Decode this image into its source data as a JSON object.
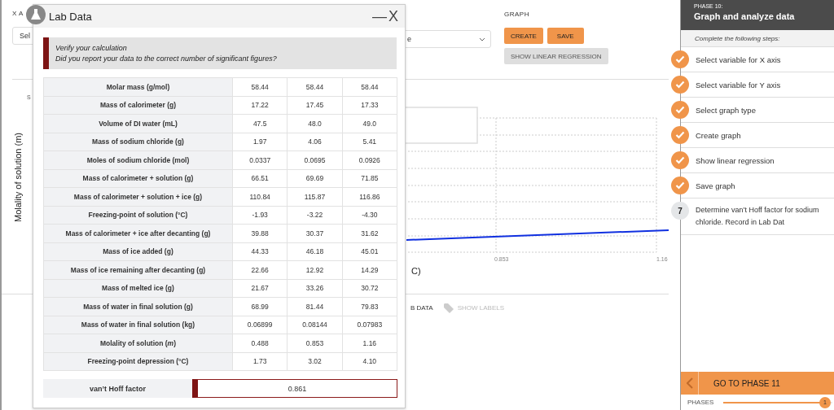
{
  "background": {
    "x_axis_label": "X A",
    "x_select": {
      "value": "Sel"
    },
    "graph_select": {
      "value": "e"
    },
    "graph_label": "GRAPH",
    "buttons": [
      {
        "label": "CREATE",
        "kind": "primary"
      },
      {
        "label": "SAVE",
        "kind": "primary"
      },
      {
        "label": "SHOW LINEAR REGRESSION",
        "kind": "secondary"
      }
    ],
    "side_label": "S",
    "y_axis_label": "Molality of solution (m)",
    "x_ticks": [
      "0.853",
      "1.16"
    ],
    "x_axis_label_fragment": "C)",
    "footer": [
      {
        "label": "B DATA",
        "disabled": false,
        "icon": false
      },
      {
        "label": "SHOW LABELS",
        "disabled": true,
        "icon": true
      }
    ]
  },
  "lab_data": {
    "title": "Lab Data",
    "minimize": "—",
    "close": "X",
    "alert": {
      "title": "Verify your calculation",
      "message": "Did you report your data to the correct number of significant figures?"
    },
    "rows": [
      {
        "label": "Molar mass (g/mol)",
        "values": [
          "58.44",
          "58.44",
          "58.44"
        ]
      },
      {
        "label": "Mass of calorimeter (g)",
        "values": [
          "17.22",
          "17.45",
          "17.33"
        ]
      },
      {
        "label": "Volume of DI water (mL)",
        "values": [
          "47.5",
          "48.0",
          "49.0"
        ]
      },
      {
        "label": "Mass of sodium chloride (g)",
        "values": [
          "1.97",
          "4.06",
          "5.41"
        ]
      },
      {
        "label": "Moles of sodium chloride (mol)",
        "values": [
          "0.0337",
          "0.0695",
          "0.0926"
        ]
      },
      {
        "label": "Mass of calorimeter + solution (g)",
        "values": [
          "66.51",
          "69.69",
          "71.85"
        ]
      },
      {
        "label": "Mass of calorimeter + solution + ice (g)",
        "values": [
          "110.84",
          "115.87",
          "116.86"
        ]
      },
      {
        "label": "Freezing-point of solution (°C)",
        "values": [
          "-1.93",
          "-3.22",
          "-4.30"
        ]
      },
      {
        "label": "Mass of calorimeter + ice after decanting (g)",
        "values": [
          "39.88",
          "30.37",
          "31.62"
        ]
      },
      {
        "label": "Mass of ice added (g)",
        "values": [
          "44.33",
          "46.18",
          "45.01"
        ]
      },
      {
        "label": "Mass of ice remaining after decanting (g)",
        "values": [
          "22.66",
          "12.92",
          "14.29"
        ]
      },
      {
        "label": "Mass of melted ice (g)",
        "values": [
          "21.67",
          "33.26",
          "30.72"
        ]
      },
      {
        "label": "Mass of water in final solution (g)",
        "values": [
          "68.99",
          "81.44",
          "79.83"
        ]
      },
      {
        "label": "Mass of water in final solution (kg)",
        "values": [
          "0.06899",
          "0.08144",
          "0.07983"
        ]
      },
      {
        "label": "Molality of solution (*m*)",
        "values": [
          "0.488",
          "0.853",
          "1.16"
        ]
      },
      {
        "label": "Freezing-point depression (°C)",
        "values": [
          "1.73",
          "3.02",
          "4.10"
        ]
      }
    ],
    "vant_hoff": {
      "label": "van’t Hoff factor",
      "value": "0.861",
      "invalid": true
    }
  },
  "phase": {
    "kicker": "PHASE 10:",
    "title": "Graph and analyze data",
    "instructions": "Complete the following steps:",
    "steps": [
      {
        "label": "Select variable for X axis",
        "done": true
      },
      {
        "label": "Select variable for Y axis",
        "done": true
      },
      {
        "label": "Select graph type",
        "done": true
      },
      {
        "label": "Create graph",
        "done": true
      },
      {
        "label": "Show linear regression",
        "done": true
      },
      {
        "label": "Save graph",
        "done": true
      },
      {
        "number": "7",
        "label": "Determine van’t Hoff factor for sodium chloride. Record in Lab Dat",
        "done": false
      }
    ],
    "next_button": "GO TO PHASE 11",
    "phases_label": "PHASES",
    "level": 0.97,
    "current": "1"
  }
}
